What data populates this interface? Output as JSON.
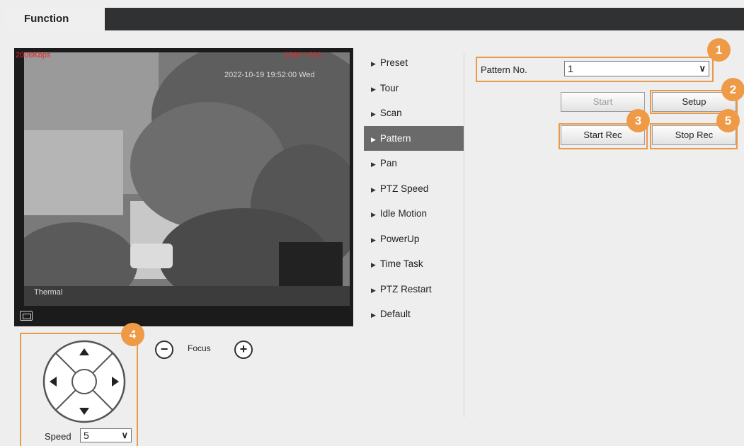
{
  "tabs": {
    "function": "Function"
  },
  "video": {
    "bitrate": "2008Kbps",
    "resolution": "1280 * 960",
    "timestamp": "2022-10-19 19:52:00 Wed",
    "channel": "Thermal",
    "window_icon": "window-icon"
  },
  "menu": {
    "items": [
      {
        "label": "Preset"
      },
      {
        "label": "Tour"
      },
      {
        "label": "Scan"
      },
      {
        "label": "Pattern",
        "active": true
      },
      {
        "label": "Pan"
      },
      {
        "label": "PTZ Speed"
      },
      {
        "label": "Idle Motion"
      },
      {
        "label": "PowerUp"
      },
      {
        "label": "Time Task"
      },
      {
        "label": "PTZ Restart"
      },
      {
        "label": "Default"
      }
    ]
  },
  "pattern": {
    "label": "Pattern No.",
    "value": "1",
    "start": "Start",
    "setup": "Setup",
    "start_rec": "Start Rec",
    "stop_rec": "Stop Rec"
  },
  "badges": [
    "1",
    "2",
    "3",
    "4",
    "5"
  ],
  "ptz": {
    "speed_label": "Speed",
    "speed_value": "5",
    "focus_label": "Focus",
    "minus": "−",
    "plus": "+"
  },
  "colors": {
    "accent": "#ef9a47",
    "active_menu": "#6a6a6a",
    "topbar": "#303133",
    "overlay_red": "#e3262b"
  }
}
